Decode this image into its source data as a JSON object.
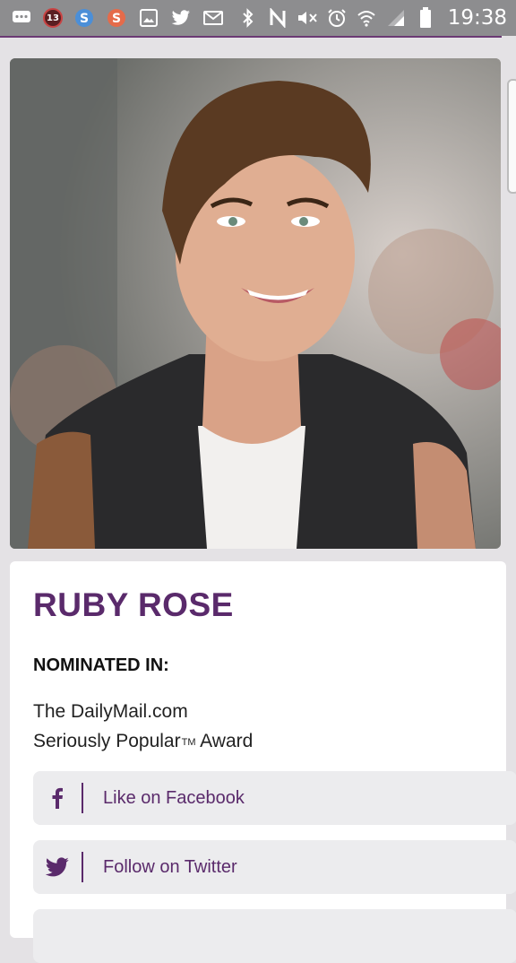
{
  "status_bar": {
    "notification_count": "13",
    "time": "19:38"
  },
  "profile": {
    "name": "RUBY ROSE",
    "nominated_heading": "NOMINATED IN:",
    "award_line_1": "The DailyMail.com",
    "award_line_2_prefix": "Seriously Popular",
    "award_line_2_tm": "TM",
    "award_line_2_suffix": " Award"
  },
  "social": {
    "facebook_label": "Like on Facebook",
    "twitter_label": "Follow on Twitter"
  },
  "colors": {
    "accent": "#5a2a6b",
    "button_bg": "#ececee",
    "page_bg": "#e4e2e5"
  }
}
